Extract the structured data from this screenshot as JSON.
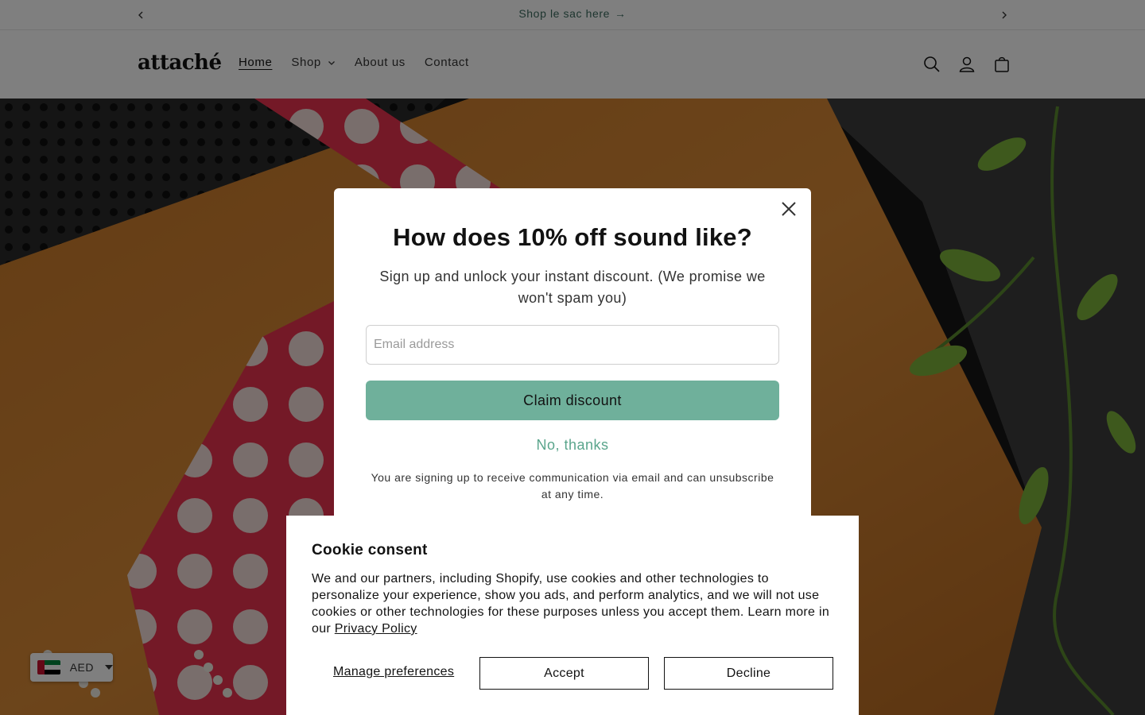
{
  "announcement": {
    "text": "Shop le sac here",
    "arrow": "→",
    "prev_icon": "chevron-left-icon",
    "next_icon": "chevron-right-icon"
  },
  "header": {
    "logo": "attaché",
    "nav": [
      {
        "label": "Home",
        "active": true
      },
      {
        "label": "Shop",
        "has_dropdown": true
      },
      {
        "label": "About us"
      },
      {
        "label": "Contact"
      }
    ],
    "icons": [
      "search-icon",
      "account-icon",
      "cart-icon"
    ]
  },
  "currency": {
    "code": "AED",
    "flag": "uae-flag-icon"
  },
  "modal": {
    "title": "How does 10% off sound like?",
    "subtitle": "Sign up and unlock your instant discount. (We promise we won't spam you)",
    "email_placeholder": "Email address",
    "email_value": "",
    "claim_label": "Claim discount",
    "decline_label": "No, thanks",
    "disclaimer": "You are signing up to receive communication via email and can unsubscribe at any time.",
    "accent_color": "#6fb09b"
  },
  "cookie": {
    "title": "Cookie consent",
    "text_before_link": "We and our partners, including Shopify, use cookies and other technologies to personalize your experience, show you ads, and perform analytics, and we will not use cookies or other technologies for these purposes unless you accept them. Learn more in our ",
    "link_label": "Privacy Policy",
    "manage_label": "Manage preferences",
    "accept_label": "Accept",
    "decline_label": "Decline"
  }
}
